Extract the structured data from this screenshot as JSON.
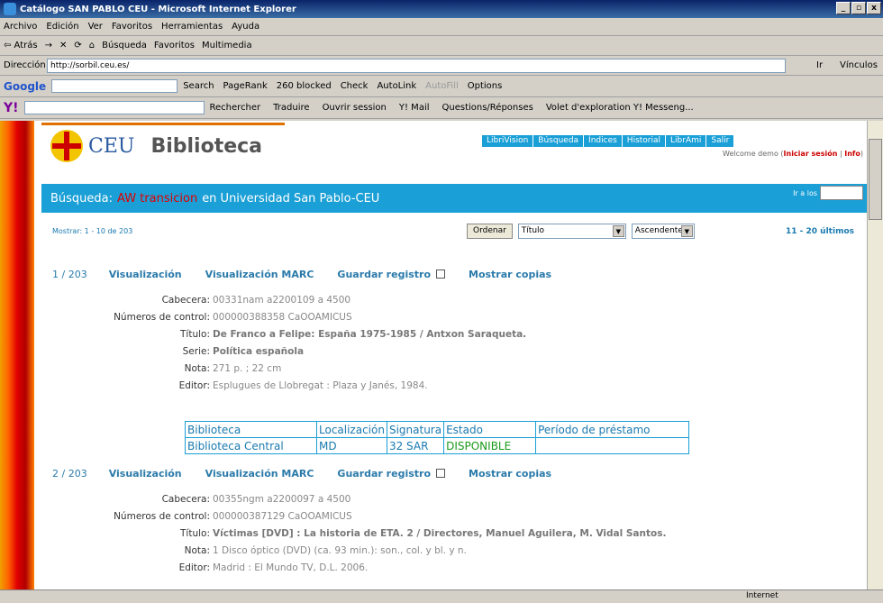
{
  "window": {
    "title": "Catálogo SAN PABLO CEU - Microsoft Internet Explorer"
  },
  "menu": [
    "Archivo",
    "Edición",
    "Ver",
    "Favoritos",
    "Herramientas",
    "Ayuda"
  ],
  "toolbar": [
    "⇦ Atrás",
    "→",
    "✕",
    "⟳",
    "⌂",
    "Búsqueda",
    "Favoritos",
    "Multimedia"
  ],
  "address": {
    "label": "Dirección",
    "url": "http://sorbil.ceu.es/",
    "go": "Ir",
    "links": "Vínculos"
  },
  "google": {
    "label": "Google",
    "items": [
      "Search",
      "PageRank",
      "260 blocked",
      "Check",
      "AutoLink",
      "AutoFill",
      "Options"
    ]
  },
  "yahoo": {
    "items": [
      "Rechercher",
      "Traduire",
      "Ouvrir session",
      "Y! Mail",
      "Questions/Réponses",
      "Volet d'exploration Y! Messeng..."
    ]
  },
  "site": {
    "ceu": "CEU",
    "biblioteca": "Biblioteca",
    "nav": [
      "LibriVision",
      "Búsqueda",
      "Índices",
      "Historial",
      "LibrAmi",
      "Salir"
    ],
    "welcome_prefix": "Welcome demo (",
    "welcome_login": "Iniciar sesión",
    "welcome_sep": " | ",
    "welcome_info": "Info",
    "welcome_suffix": ")"
  },
  "search": {
    "prefix": "Búsqueda:",
    "term": "AW transicion",
    "suffix": "en Universidad San Pablo-CEU",
    "ir_label": "Ir a los"
  },
  "results": {
    "mostrar": "Mostrar: 1 - 10 de 203",
    "ordenar": "Ordenar",
    "sort_field": "Título",
    "sort_dir": "Ascendente",
    "pages": "11 - 20 últimos"
  },
  "actions": {
    "view": "Visualización",
    "marc": "Visualización MARC",
    "save": "Guardar registro",
    "copies": "Mostrar copias"
  },
  "records": [
    {
      "num": "1 / 203",
      "fields": [
        {
          "label": "Cabecera:",
          "value": "00331nam a2200109 a 4500"
        },
        {
          "label": "Números de control:",
          "value": "000000388358 CaOOAMICUS"
        },
        {
          "label": "Título:",
          "value": "De Franco a Felipe: España 1975-1985 / Antxon Saraqueta."
        },
        {
          "label": "Serie:",
          "value": "Política española"
        },
        {
          "label": "Nota:",
          "value": "271 p. ; 22 cm"
        },
        {
          "label": "Editor:",
          "value": "Esplugues de Llobregat : Plaza y Janés, 1984."
        }
      ]
    },
    {
      "num": "2 / 203",
      "fields": [
        {
          "label": "Cabecera:",
          "value": "00355ngm a2200097 a 4500"
        },
        {
          "label": "Números de control:",
          "value": "000000387129 CaOOAMICUS"
        },
        {
          "label": "Título:",
          "value": "Víctimas [DVD] : La historia de ETA. 2 / Directores, Manuel Aguilera, M. Vidal Santos."
        },
        {
          "label": "Nota:",
          "value": "1 Disco óptico (DVD) (ca. 93 min.): son., col. y bl. y n."
        },
        {
          "label": "Editor:",
          "value": "Madrid : El Mundo TV, D.L. 2006."
        }
      ]
    }
  ],
  "copies": {
    "headers": [
      "Biblioteca",
      "Localización",
      "Signatura",
      "Estado",
      "Período de préstamo"
    ],
    "row": [
      "Biblioteca Central",
      "MD",
      "32 SAR",
      "DISPONIBLE",
      ""
    ]
  },
  "status": {
    "zone": "Internet"
  }
}
